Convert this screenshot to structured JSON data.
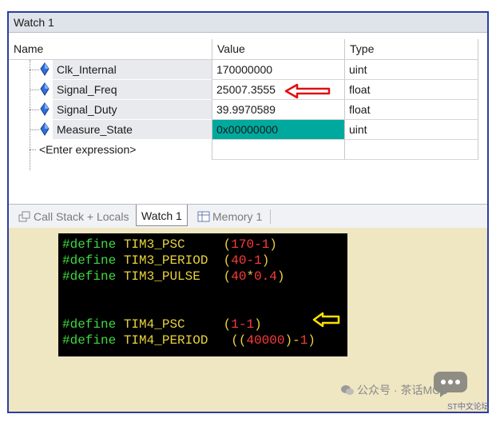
{
  "window": {
    "title": "Watch 1"
  },
  "columns": {
    "name": "Name",
    "value": "Value",
    "type": "Type"
  },
  "rows": [
    {
      "name": "Clk_Internal",
      "value": "170000000",
      "type": "uint"
    },
    {
      "name": "Signal_Freq",
      "value": "25007.3555",
      "type": "float"
    },
    {
      "name": "Signal_Duty",
      "value": "39.9970589",
      "type": "float"
    },
    {
      "name": "Measure_State",
      "value": "0x00000000",
      "type": "uint"
    }
  ],
  "enter_expression": "<Enter expression>",
  "tabs": [
    {
      "label": "Call Stack + Locals"
    },
    {
      "label": "Watch 1"
    },
    {
      "label": "Memory 1"
    }
  ],
  "code": {
    "lines": [
      {
        "kw": "#define",
        "name": "TIM3_PSC",
        "expr": [
          "(",
          "170",
          "-",
          "1",
          ")"
        ]
      },
      {
        "kw": "#define",
        "name": "TIM3_PERIOD",
        "expr": [
          "(",
          "40",
          "-",
          "1",
          ")"
        ]
      },
      {
        "kw": "#define",
        "name": "TIM3_PULSE",
        "expr": [
          "(",
          "40",
          "*",
          "0.4",
          ")"
        ]
      },
      {
        "kw": "#define",
        "name": "TIM4_PSC",
        "expr": [
          "(",
          "1",
          "-",
          "1",
          ")"
        ]
      },
      {
        "kw": "#define",
        "name": "TIM4_PERIOD",
        "expr": [
          "((",
          "40000",
          ")-",
          "1",
          ")"
        ]
      }
    ]
  },
  "watermark": {
    "text": "公众号 · 茶话MCU",
    "small": "ST中文论坛"
  },
  "colors": {
    "highlight_value": "#00a99d",
    "arrow_red": "#e01010",
    "arrow_yellow": "#ffe000"
  }
}
